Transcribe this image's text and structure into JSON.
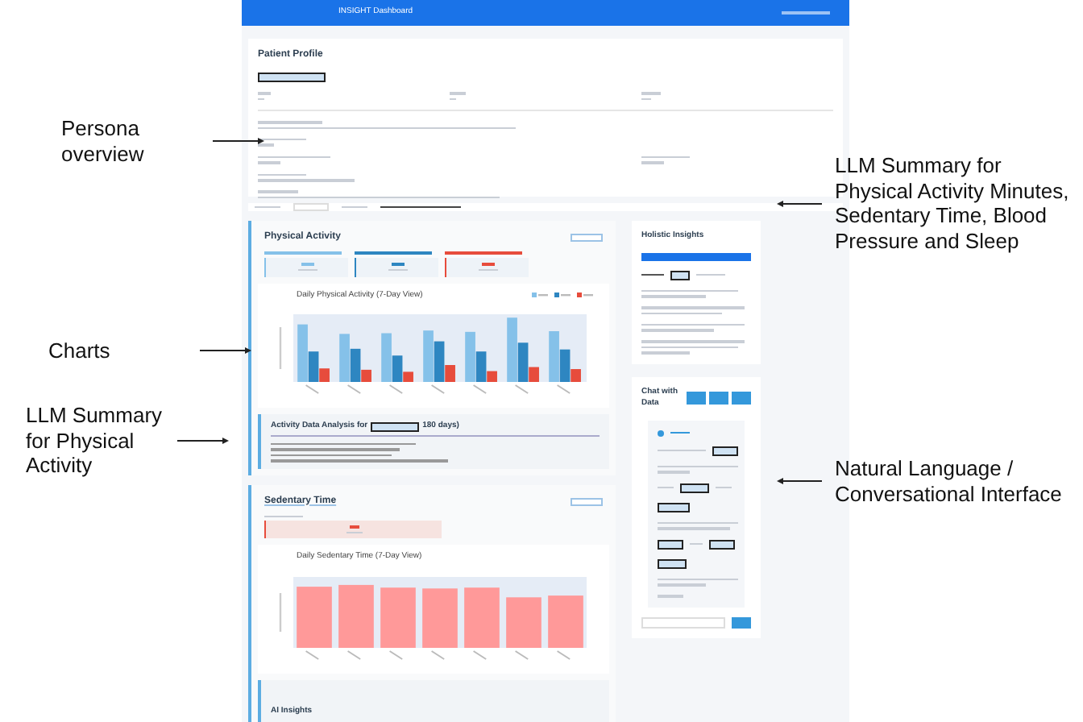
{
  "left_annotations": [
    "Persona overview",
    "Charts",
    "LLM Summary for Physical Activity"
  ],
  "right_annotations": [
    "LLM Summary for Physical Activity Minutes, Sedentary Time, Blood Pressure and Sleep",
    "Natural Language / Conversational Interface"
  ],
  "header": {
    "title": "INSIGHT Dashboard"
  },
  "profile": {
    "title": "Patient Profile"
  },
  "physical": {
    "title": "Physical Activity",
    "chart_title": "Daily Physical Activity (7-Day View)"
  },
  "analysis": {
    "title_start": "Activity Data Analysis for",
    "title_end": "180 days)"
  },
  "sedentary": {
    "title": "Sedentary Time",
    "chart_title": "Daily Sedentary Time (7-Day View)"
  },
  "ai_insights": {
    "title": "AI Insights"
  },
  "holistic": {
    "title": "Holistic Insights"
  },
  "chat": {
    "title": "Chat with Data"
  }
}
